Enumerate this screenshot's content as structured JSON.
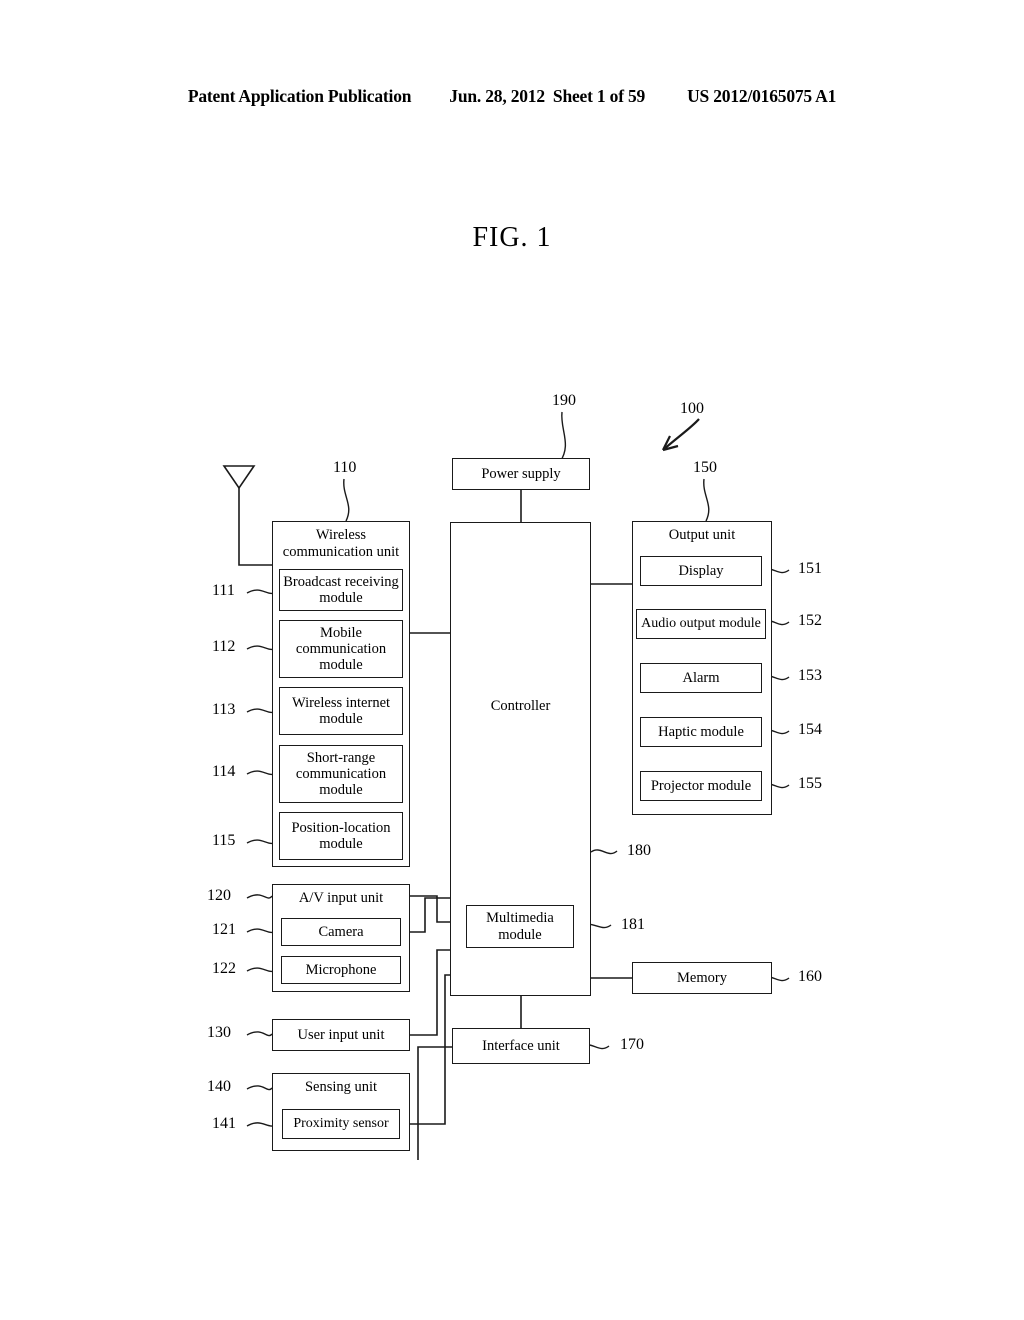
{
  "header": {
    "publication": "Patent Application Publication",
    "date": "Jun. 28, 2012",
    "sheet": "Sheet 1 of 59",
    "number": "US 2012/0165075 A1"
  },
  "figure": {
    "title": "FIG. 1"
  },
  "diagram": {
    "type": "block-diagram",
    "device_ref": "100",
    "blocks": {
      "power_supply": {
        "label": "Power supply",
        "ref": "190"
      },
      "controller": {
        "label": "Controller",
        "ref": "180"
      },
      "multimedia_module": {
        "label": "Multimedia module",
        "line1": "Multimedia",
        "line2": "module",
        "ref": "181"
      },
      "memory": {
        "label": "Memory",
        "ref": "160"
      },
      "interface_unit": {
        "label": "Interface unit",
        "ref": "170"
      },
      "wireless_unit": {
        "label": "Wireless communication unit",
        "line1": "Wireless",
        "line2": "communication unit",
        "ref": "110",
        "children": [
          {
            "label": "Broadcast receiving module",
            "line1": "Broadcast receiving",
            "line2": "module",
            "ref": "111"
          },
          {
            "label": "Mobile communication module",
            "line1": "Mobile",
            "line2": "communication",
            "line3": "module",
            "ref": "112"
          },
          {
            "label": "Wireless internet module",
            "line1": "Wireless internet",
            "line2": "module",
            "ref": "113"
          },
          {
            "label": "Short-range communication module",
            "line1": "Short-range",
            "line2": "communication",
            "line3": "module",
            "ref": "114"
          },
          {
            "label": "Position-location module",
            "line1": "Position-location",
            "line2": "module",
            "ref": "115"
          }
        ]
      },
      "av_input_unit": {
        "label": "A/V input unit",
        "ref": "120",
        "children": [
          {
            "label": "Camera",
            "ref": "121"
          },
          {
            "label": "Microphone",
            "ref": "122"
          }
        ]
      },
      "user_input_unit": {
        "label": "User input unit",
        "ref": "130"
      },
      "sensing_unit": {
        "label": "Sensing unit",
        "ref": "140",
        "children": [
          {
            "label": "Proximity sensor",
            "ref": "141"
          }
        ]
      },
      "output_unit": {
        "label": "Output unit",
        "ref": "150",
        "children": [
          {
            "label": "Display",
            "ref": "151"
          },
          {
            "label": "Audio output module",
            "ref": "152"
          },
          {
            "label": "Alarm",
            "ref": "153"
          },
          {
            "label": "Haptic module",
            "ref": "154"
          },
          {
            "label": "Projector module",
            "ref": "155"
          }
        ]
      }
    },
    "icons": {
      "antenna": "antenna-icon"
    }
  }
}
